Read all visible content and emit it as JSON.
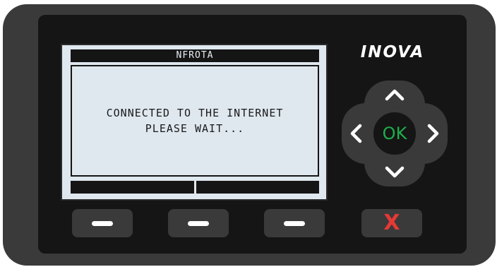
{
  "device": {
    "brand": "INOVA"
  },
  "screen": {
    "title": "NFROTA",
    "message_line_1": "CONNECTED TO THE INTERNET",
    "message_line_2": "PLEASE WAIT..."
  },
  "dpad": {
    "ok_label": "OK",
    "up_icon": "chevron-up-icon",
    "down_icon": "chevron-down-icon",
    "left_icon": "chevron-left-icon",
    "right_icon": "chevron-right-icon"
  },
  "buttons": {
    "soft_1_icon": "dash-icon",
    "soft_2_icon": "dash-icon",
    "soft_3_icon": "dash-icon",
    "cancel_label": "X"
  },
  "colors": {
    "ok_green": "#1fae4b",
    "cancel_red": "#e53935",
    "screen_bg": "#dfe8ef",
    "body": "#3a3a3a",
    "faceplate": "#151515"
  }
}
